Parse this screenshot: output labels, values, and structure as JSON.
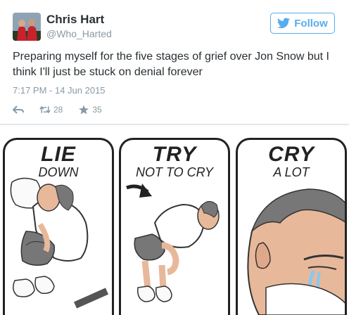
{
  "tweet": {
    "name": "Chris Hart",
    "handle": "@Who_Harted",
    "follow_label": "Follow",
    "text": "Preparing myself for the five stages of grief over Jon Snow but I think I'll just be stuck on denial forever",
    "timestamp": "7:17 PM - 14 Jun 2015",
    "actions": {
      "reply_icon": "reply-icon",
      "retweet_icon": "retweet-icon",
      "retweet_count": "28",
      "favorite_icon": "star-icon",
      "favorite_count": "35"
    },
    "colors": {
      "accent": "#55acee",
      "muted": "#8899a6",
      "text": "#292f33"
    }
  },
  "comic": {
    "panels": [
      {
        "big": "LIE",
        "small": "DOWN"
      },
      {
        "big": "TRY",
        "small": "NOT TO CRY"
      },
      {
        "big": "CRY",
        "small": "A LOT"
      }
    ]
  }
}
